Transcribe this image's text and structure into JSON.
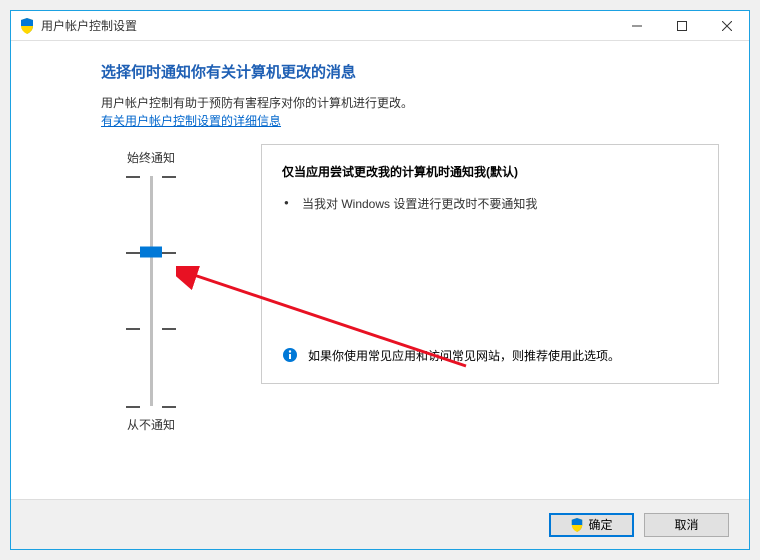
{
  "window": {
    "title": "用户帐户控制设置"
  },
  "content": {
    "heading": "选择何时通知你有关计算机更改的消息",
    "description": "用户帐户控制有助于预防有害程序对你的计算机进行更改。",
    "link": "有关用户帐户控制设置的详细信息"
  },
  "slider": {
    "top_label": "始终通知",
    "bottom_label": "从不通知",
    "level_count": 4,
    "current_level": 1
  },
  "detail": {
    "title": "仅当应用尝试更改我的计算机时通知我(默认)",
    "items": [
      "当我对 Windows 设置进行更改时不要通知我"
    ],
    "recommendation": "如果你使用常见应用和访问常见网站，则推荐使用此选项。"
  },
  "buttons": {
    "ok": "确定",
    "cancel": "取消"
  }
}
